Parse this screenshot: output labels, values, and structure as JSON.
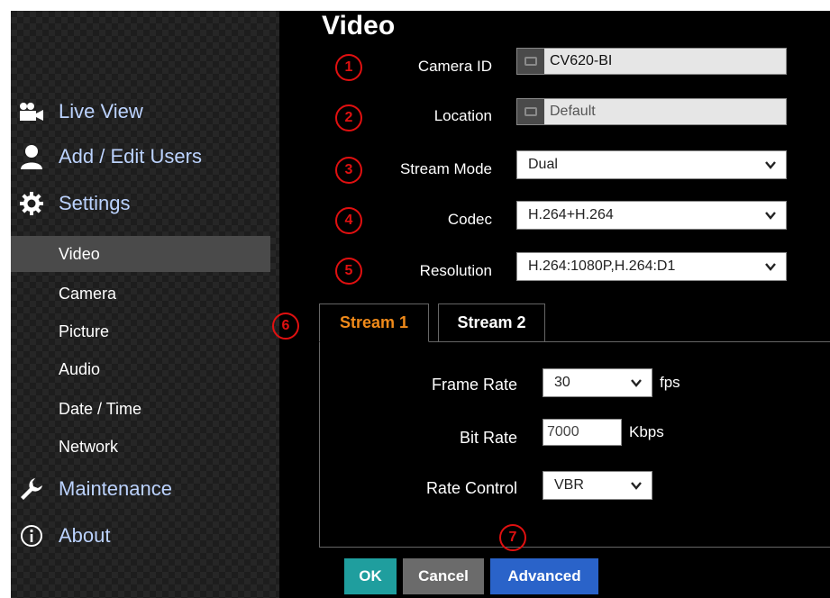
{
  "sidebar": {
    "main_items": [
      {
        "label": "Live View",
        "icon": "video-camera-icon"
      },
      {
        "label": "Add / Edit Users",
        "icon": "user-icon"
      },
      {
        "label": "Settings",
        "icon": "gear-icon"
      },
      {
        "label": "Maintenance",
        "icon": "wrench-icon"
      },
      {
        "label": "About",
        "icon": "info-icon"
      }
    ],
    "sub_items": [
      "Video",
      "Camera",
      "Picture",
      "Audio",
      "Date / Time",
      "Network"
    ],
    "active_sub": "Video"
  },
  "main": {
    "title": "Video",
    "fields": {
      "camera_id": {
        "label": "Camera ID",
        "value": "CV620-BI"
      },
      "location": {
        "label": "Location",
        "value": "Default"
      },
      "stream_mode": {
        "label": "Stream Mode",
        "value": "Dual"
      },
      "codec": {
        "label": "Codec",
        "value": "H.264+H.264"
      },
      "resolution": {
        "label": "Resolution",
        "value": "H.264:1080P,H.264:D1"
      }
    },
    "markers": [
      "1",
      "2",
      "3",
      "4",
      "5",
      "6",
      "7"
    ],
    "tabs": [
      {
        "label": "Stream 1",
        "active": true
      },
      {
        "label": "Stream 2",
        "active": false
      }
    ],
    "stream": {
      "frame_rate": {
        "label": "Frame Rate",
        "value": "30",
        "unit": "fps"
      },
      "bit_rate": {
        "label": "Bit Rate",
        "value": "7000",
        "unit": "Kbps"
      },
      "rate_control": {
        "label": "Rate Control",
        "value": "VBR"
      }
    },
    "buttons": {
      "ok": "OK",
      "cancel": "Cancel",
      "advanced": "Advanced"
    }
  },
  "colors": {
    "sidebar_bg": "#1d1d1d",
    "nav_label": "#bcd3ff",
    "active_tab": "#f08a1a",
    "marker": "#e01010",
    "ok_button": "#1f9e9e",
    "cancel_button": "#6b6b6b",
    "advanced_button": "#2a63c9"
  }
}
